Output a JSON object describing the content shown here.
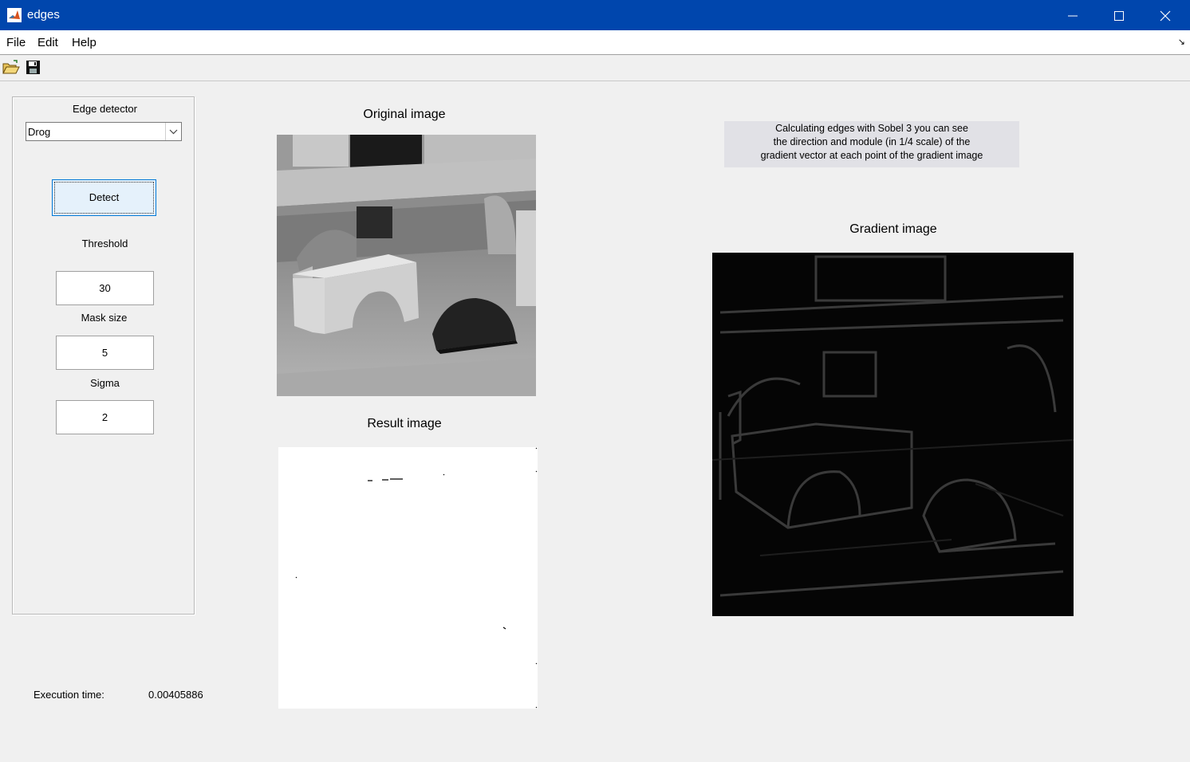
{
  "window": {
    "title": "edges",
    "app_icon": "matlab-icon"
  },
  "menu": {
    "file": "File",
    "edit": "Edit",
    "help": "Help"
  },
  "toolbar": {
    "open_icon": "open-folder-icon",
    "save_icon": "save-disk-icon"
  },
  "controls": {
    "detector_label": "Edge detector",
    "detector_value": "Drog",
    "detect_button": "Detect",
    "threshold_label": "Threshold",
    "threshold_value": "30",
    "mask_size_label": "Mask size",
    "mask_size_value": "5",
    "sigma_label": "Sigma",
    "sigma_value": "2"
  },
  "axes": {
    "original_title": "Original image",
    "result_title": "Result image",
    "gradient_title": "Gradient image"
  },
  "info": {
    "line1": "Calculating edges with Sobel 3 you can see",
    "line2": "the direction and module (in 1/4 scale) of the",
    "line3": "gradient vector at each point of the gradient image"
  },
  "execution": {
    "label": "Execution time:",
    "value": "0.00405886"
  },
  "colors": {
    "titlebar": "#0046ad",
    "background": "#f0f0f0",
    "button_focus": "#0078d7"
  }
}
